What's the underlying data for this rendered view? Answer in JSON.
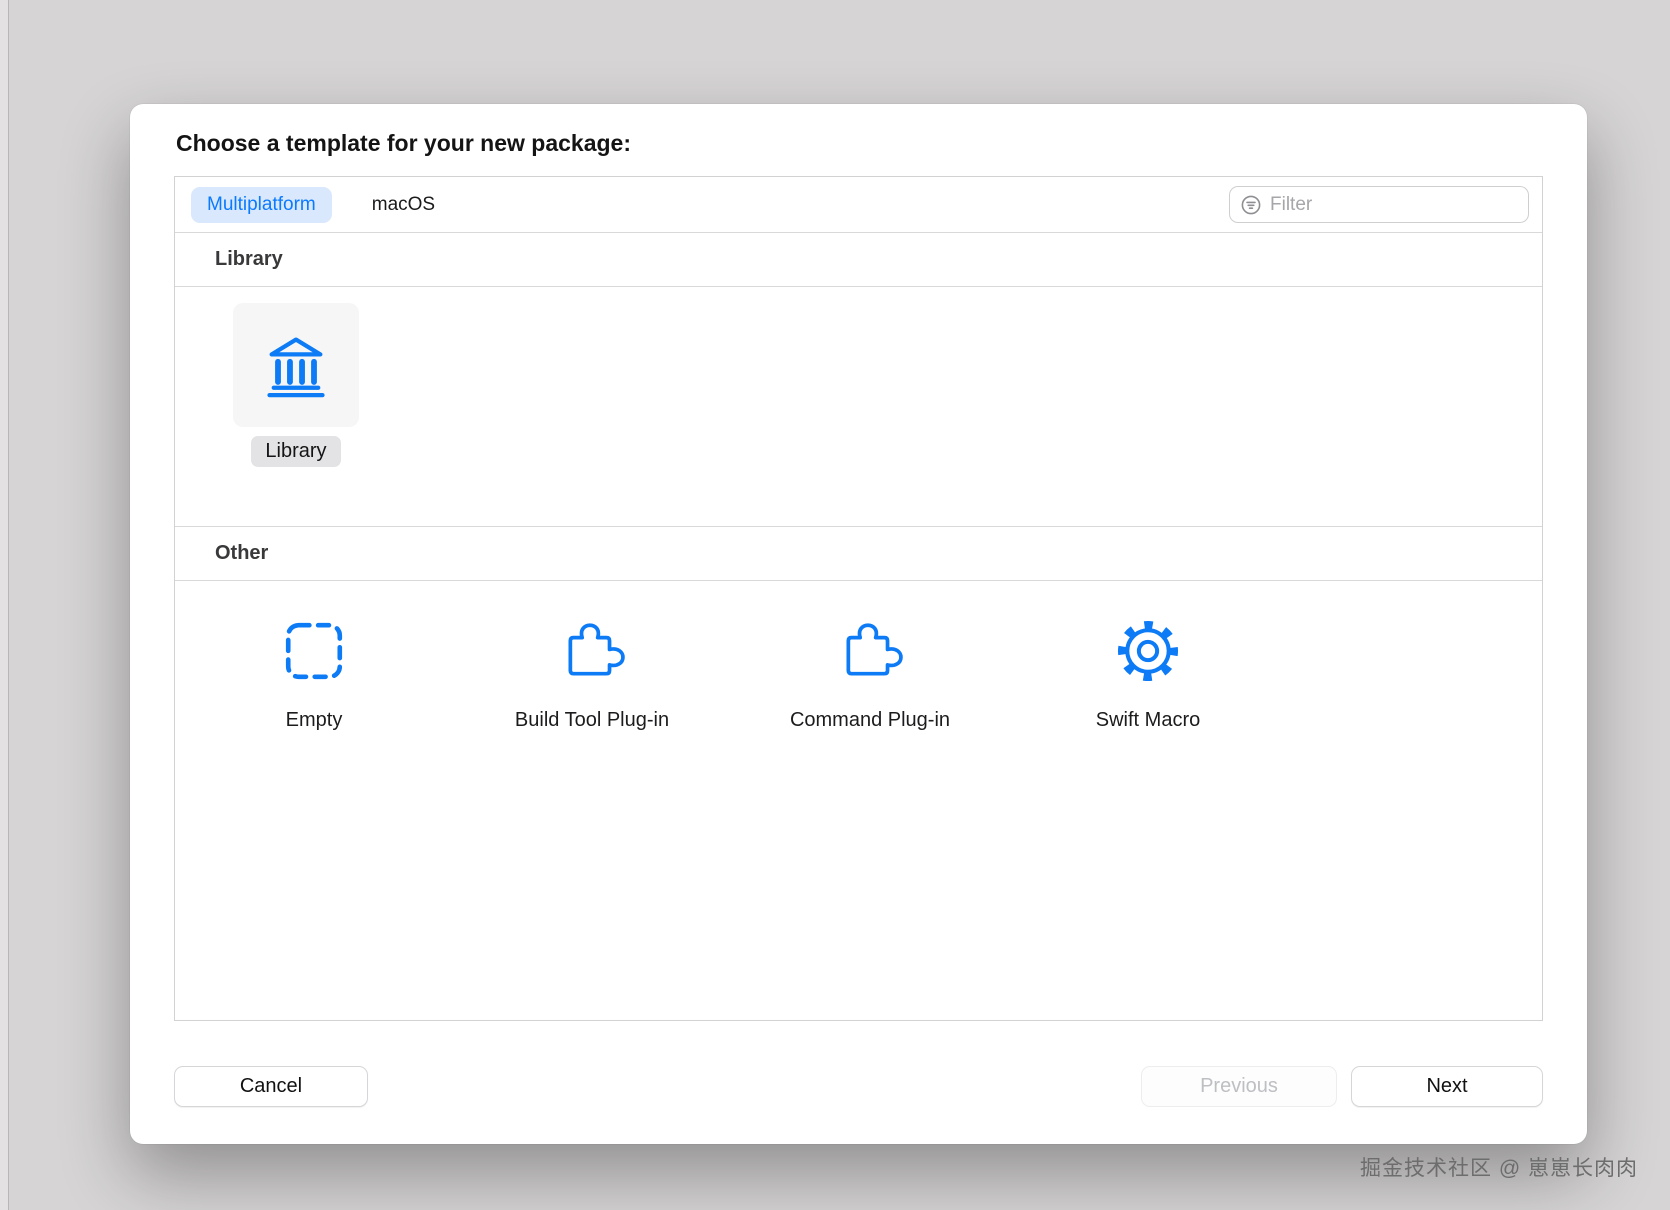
{
  "dialog": {
    "title": "Choose a template for your new package:"
  },
  "tabs": [
    {
      "label": "Multiplatform",
      "selected": true
    },
    {
      "label": "macOS",
      "selected": false
    }
  ],
  "filter": {
    "placeholder": "Filter"
  },
  "sections": {
    "library": {
      "header": "Library",
      "items": [
        {
          "label": "Library",
          "icon": "library-columns-icon",
          "selected": true
        }
      ]
    },
    "other": {
      "header": "Other",
      "items": [
        {
          "label": "Empty",
          "icon": "empty-dashed-square-icon"
        },
        {
          "label": "Build Tool Plug-in",
          "icon": "puzzle-piece-icon"
        },
        {
          "label": "Command Plug-in",
          "icon": "puzzle-piece-icon"
        },
        {
          "label": "Swift Macro",
          "icon": "gear-icon"
        }
      ]
    }
  },
  "buttons": {
    "cancel": "Cancel",
    "previous": "Previous",
    "next": "Next"
  },
  "watermark": "掘金技术社区 @ 崽崽长肉肉",
  "colors": {
    "accent": "#0a7aff",
    "icon_blue": "#0d7bf5",
    "selected_tab_bg": "#d9e8fc"
  }
}
